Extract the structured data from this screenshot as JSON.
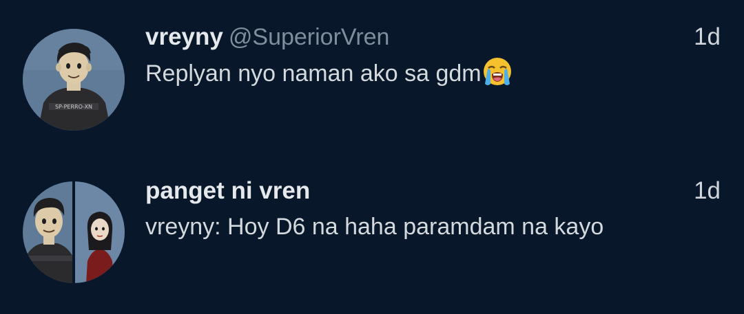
{
  "conversations": [
    {
      "display_name": "vreyny",
      "handle": "@SuperiorVren",
      "time": "1d",
      "preview": "Replyan nyo naman ako sa gdm",
      "preview_emoji": "loudly-crying-face-emoji",
      "avatar": "single-cartoon-boy-avatar"
    },
    {
      "display_name": "panget ni vren",
      "handle": "",
      "time": "1d",
      "preview": "vreyny: Hoy D6 na haha paramdam na kayo",
      "avatar": "group-split-avatar"
    }
  ],
  "colors": {
    "background": "#08182a",
    "primary_text": "#e6e9ec",
    "secondary_text": "#7f8e9c"
  }
}
